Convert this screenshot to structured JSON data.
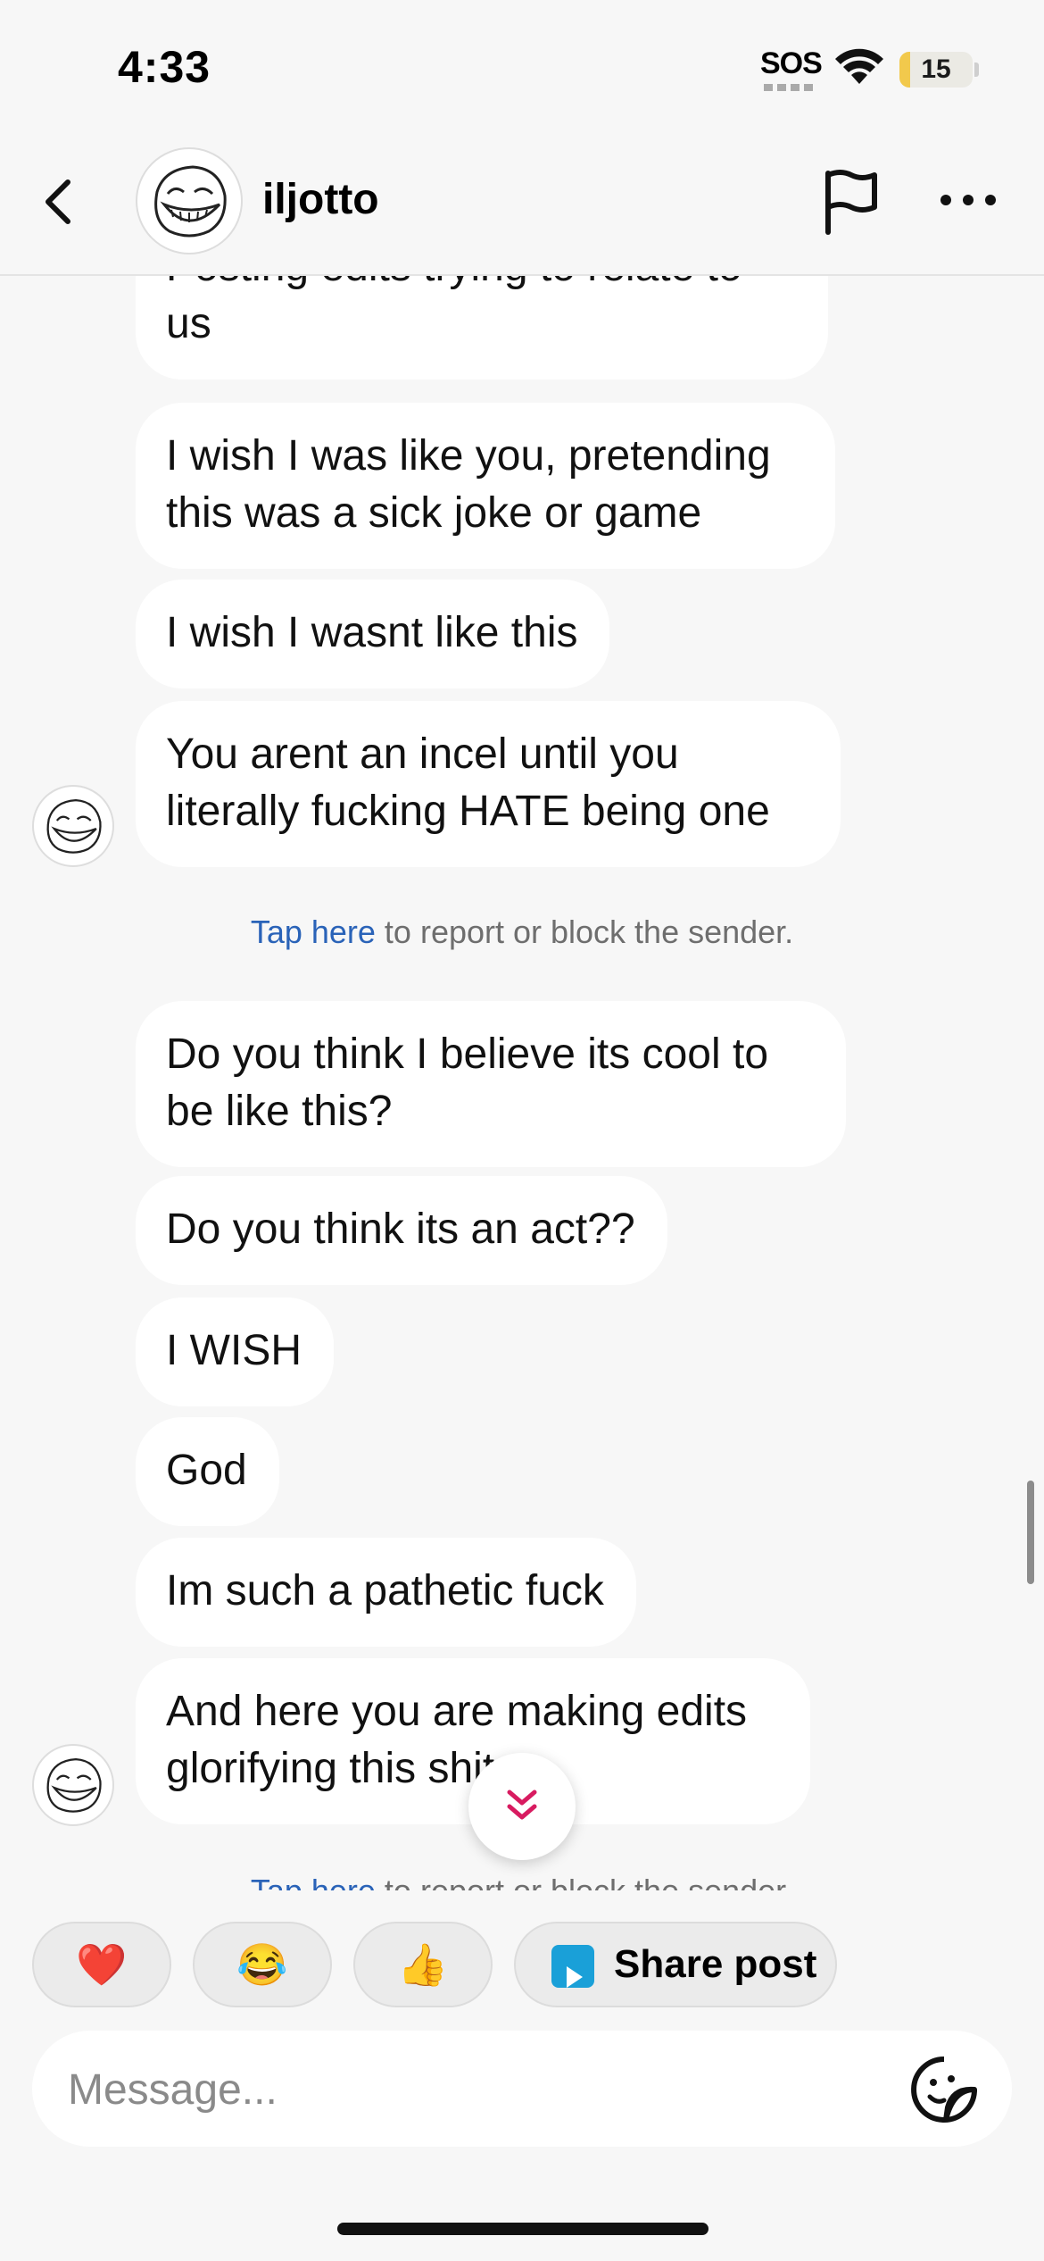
{
  "status_bar": {
    "time": "4:33",
    "sos": "SOS",
    "battery": "15",
    "battery_level_pct": 15
  },
  "header": {
    "username": "iljotto",
    "avatar_icon": "trollface-avatar",
    "back_icon": "chevron-left-icon",
    "flag_icon": "flag-icon",
    "more_icon": "more-horizontal-icon"
  },
  "messages": [
    {
      "text": "Posting edits trying to relate to us"
    },
    {
      "text": "I wish I was like you, pretending this was a sick joke or game"
    },
    {
      "text": "I wish I wasnt like this"
    },
    {
      "text": "You arent an incel until you literally fucking HATE being one"
    },
    {
      "text": "Do you think I believe its cool to be like this?"
    },
    {
      "text": "Do you think its an act??"
    },
    {
      "text": "I WISH"
    },
    {
      "text": "God"
    },
    {
      "text": "Im such a pathetic fuck"
    },
    {
      "text": "And here you are making edits glorifying this shit"
    }
  ],
  "report_notice": {
    "link": "Tap here",
    "rest": " to report or block the sender."
  },
  "quick_reactions": {
    "heart": "❤️",
    "laugh": "😂",
    "thumbs": "👍",
    "share_label": "Share post"
  },
  "composer": {
    "placeholder": "Message..."
  },
  "colors": {
    "link": "#2a63b8",
    "jump_arrow": "#d81b60",
    "share_icon": "#1aa0d8"
  }
}
